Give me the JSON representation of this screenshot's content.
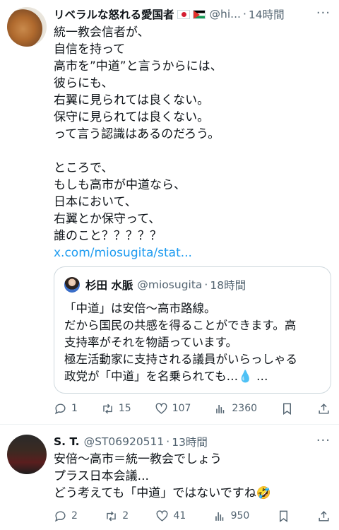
{
  "tweets": [
    {
      "name": "リベラルな怒れる愛国者",
      "handle": "@hi...",
      "dot": "·",
      "time": "14時間",
      "more": "···",
      "lines": [
        "統一教会信者が、",
        "自信を持って",
        "高市を”中道”と言うからには、",
        "彼らにも、",
        "右翼に見られては良くない。",
        "保守に見られては良くない。",
        "って言う認識はあるのだろう。",
        "",
        "ところで、",
        "もしも高市が中道なら、",
        "日本において、",
        "右翼とか保守って、",
        "誰のこと？？？？？"
      ],
      "link": "x.com/miosugita/stat...",
      "quote": {
        "name": "杉田 水脈",
        "handle": "@miosugita",
        "dot": "·",
        "time": "18時間",
        "lines": [
          "「中道」は安倍〜高市路線。",
          "だから国民の共感を得ることができます。高",
          "支持率がそれを物語っています。",
          "極左活動家に支持される議員がいらっしゃる",
          "政党が「中道」を名乗られても…💧 …"
        ]
      },
      "stats": {
        "replies": "1",
        "reposts": "15",
        "likes": "107",
        "views": "2360"
      }
    },
    {
      "name": "S. T.",
      "handle": "@ST06920511",
      "dot": "·",
      "time": "13時間",
      "more": "···",
      "lines": [
        "安倍〜高市＝統一教会でしょう",
        "プラス日本会議...",
        "どう考えても「中道」ではないですね🤣"
      ],
      "stats": {
        "replies": "2",
        "reposts": "2",
        "likes": "41",
        "views": "950"
      }
    }
  ],
  "icons": [
    "reply-icon",
    "repost-icon",
    "like-icon",
    "views-icon",
    "bookmark-icon",
    "share-icon",
    "more-icon"
  ],
  "colors": {
    "link": "#1d9bf0",
    "secondary": "#536471",
    "border": "#cfd9de"
  }
}
